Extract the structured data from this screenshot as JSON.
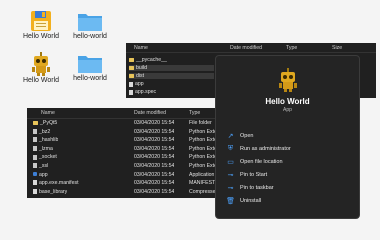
{
  "desktop": {
    "icons": [
      {
        "label": "Hello World",
        "icon": "floppy-disk-icon"
      },
      {
        "label": "hello-world",
        "icon": "folder-icon"
      },
      {
        "label": "Hello World",
        "icon": "robot-icon"
      },
      {
        "label": "hello-world",
        "icon": "folder-icon"
      }
    ]
  },
  "top_window": {
    "columns": [
      "Name",
      "Date modified",
      "Type",
      "Size"
    ],
    "rows": [
      {
        "name": "__pycache__",
        "icon": "folder"
      },
      {
        "name": "build",
        "icon": "folder"
      },
      {
        "name": "dist",
        "icon": "folder"
      },
      {
        "name": "app",
        "icon": "file"
      },
      {
        "name": "app.spec",
        "icon": "file"
      }
    ]
  },
  "bottom_window": {
    "columns": [
      "Name",
      "Date modified",
      "Type"
    ],
    "rows": [
      {
        "name": "_PyQt5",
        "date": "03/04/2020 15:54",
        "type": "File folder",
        "icon": "folder"
      },
      {
        "name": "_bz2",
        "date": "03/04/2020 15:54",
        "type": "Python Exten",
        "icon": "py"
      },
      {
        "name": "_hashlib",
        "date": "03/04/2020 15:54",
        "type": "Python Exten",
        "icon": "py"
      },
      {
        "name": "_lzma",
        "date": "03/04/2020 15:54",
        "type": "Python Exten",
        "icon": "py"
      },
      {
        "name": "_socket",
        "date": "03/04/2020 15:54",
        "type": "Python Exten",
        "icon": "py"
      },
      {
        "name": "_ssl",
        "date": "03/04/2020 15:54",
        "type": "Python Exten",
        "icon": "py"
      },
      {
        "name": "app",
        "date": "03/04/2020 15:54",
        "type": "Application",
        "icon": "app"
      },
      {
        "name": "app.exe.manifest",
        "date": "03/04/2020 15:54",
        "type": "MANIFEST F",
        "icon": "file"
      },
      {
        "name": "base_library",
        "date": "03/04/2020 15:54",
        "type": "Compressed",
        "icon": "file"
      }
    ]
  },
  "context_menu": {
    "title": "Hello World",
    "subtitle": "App",
    "app_icon": "robot-icon",
    "items": [
      {
        "label": "Open",
        "icon": "open-icon"
      },
      {
        "label": "Run as administrator",
        "icon": "shield-icon"
      },
      {
        "label": "Open file location",
        "icon": "folder-open-icon"
      },
      {
        "label": "Pin to Start",
        "icon": "pin-icon"
      },
      {
        "label": "Pin to taskbar",
        "icon": "pin-icon"
      },
      {
        "label": "Uninstall",
        "icon": "trash-icon"
      }
    ]
  }
}
